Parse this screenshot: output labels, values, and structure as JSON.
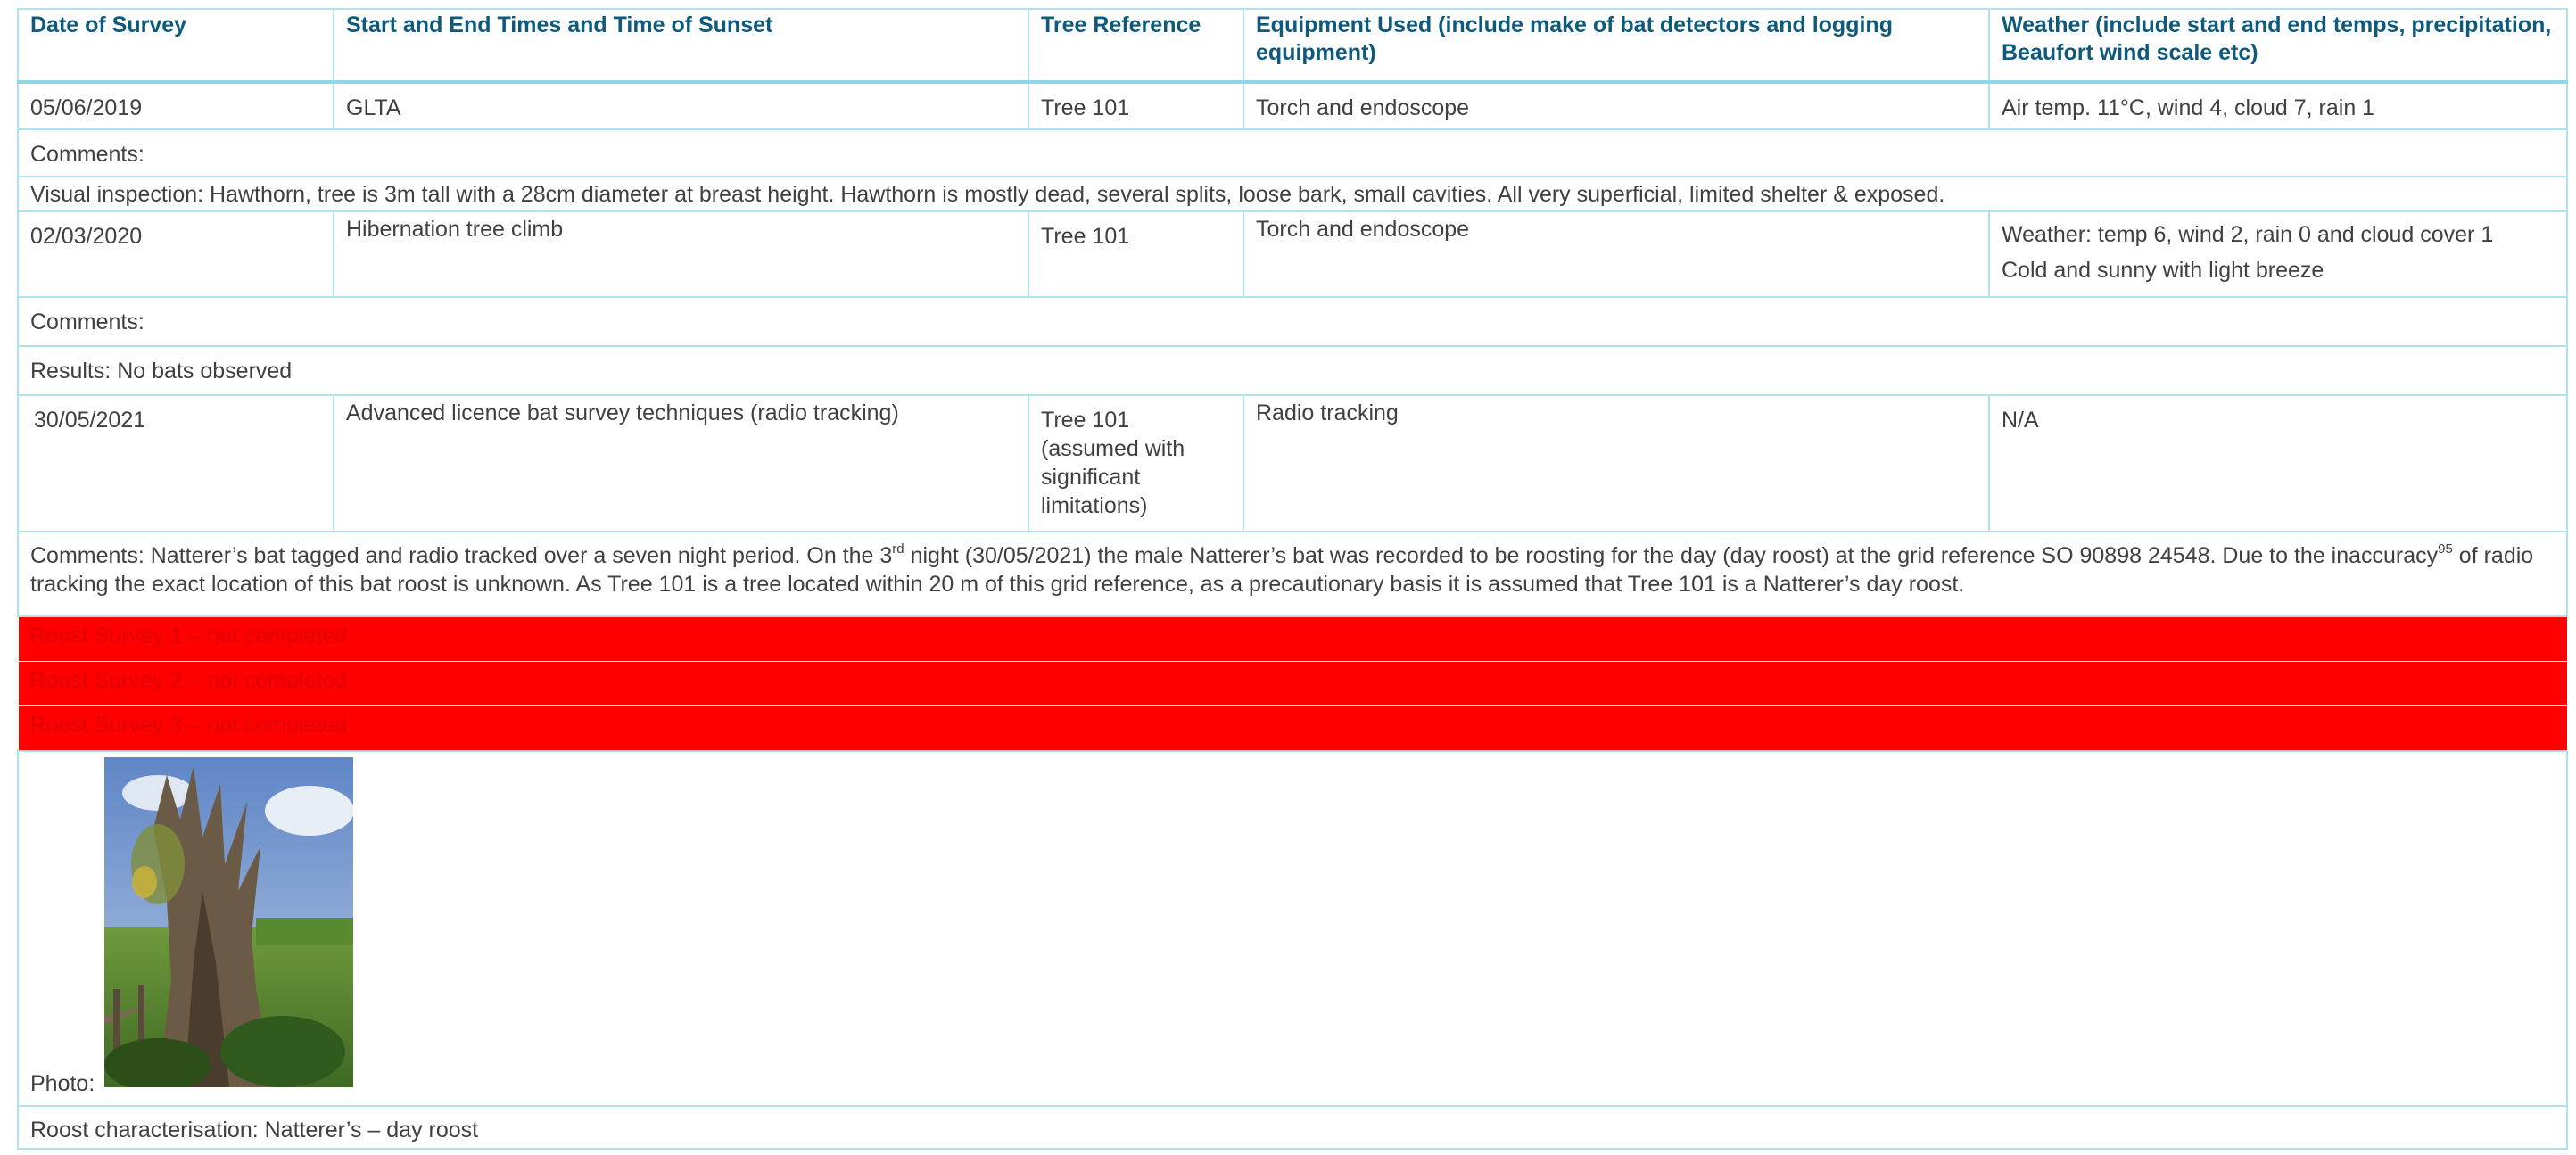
{
  "headers": {
    "date": "Date of Survey",
    "times": "Start and End Times and Time of Sunset",
    "tree": "Tree Reference",
    "equipment": "Equipment Used (include make of bat detectors and logging equipment)",
    "weather": "Weather (include start and end temps, precipitation, Beaufort wind scale etc)"
  },
  "survey1": {
    "date": "05/06/2019",
    "times": "GLTA",
    "tree": "Tree 101",
    "equipment": "Torch and endoscope",
    "weather": "Air temp. 11°C, wind 4, cloud 7, rain 1",
    "comments": "Comments:",
    "visual": "Visual inspection: Hawthorn, tree is 3m tall with a 28cm diameter at breast height. Hawthorn is mostly dead, several splits, loose bark, small cavities. All very superficial, limited shelter & exposed."
  },
  "survey2": {
    "date": "02/03/2020",
    "times": "Hibernation tree climb",
    "tree": "Tree 101",
    "equipment": "Torch and endoscope",
    "weather_line1": "Weather: temp 6, wind 2, rain 0 and cloud cover 1",
    "weather_line2": "Cold and sunny with light breeze",
    "comments": "Comments:",
    "results": "Results: No bats observed"
  },
  "survey3": {
    "date": "30/05/2021",
    "times": "Advanced licence bat survey techniques (radio tracking)",
    "tree": "Tree 101 (assumed with significant limitations)",
    "equipment": "Radio tracking",
    "weather": "N/A",
    "comments_a": "Comments: Natterer’s bat tagged and radio tracked over a seven night period. On the 3",
    "comments_sup1": "rd",
    "comments_b": " night (30/05/2021) the male Natterer’s bat was recorded to be roosting for the day (day roost) at the grid reference SO 90898 24548. Due to the inaccuracy",
    "comments_sup2": "95",
    "comments_c": " of radio tracking the exact location of this bat roost is unknown. As Tree 101 is a tree located within 20 m of this grid reference, as a precautionary basis it is assumed that Tree 101 is a Natterer’s day roost."
  },
  "roost_surveys": [
    "Roost Survey 1 – not completed",
    "Roost Survey 2 – not completed",
    "Roost Survey 3 – not completed"
  ],
  "photo_label": "Photo:",
  "roost_characterisation": "Roost characterisation: Natterer’s – day roost",
  "colors": {
    "header_text": "#0e5a7d",
    "border": "#aee3ee",
    "alert_fill": "#ff0000"
  }
}
